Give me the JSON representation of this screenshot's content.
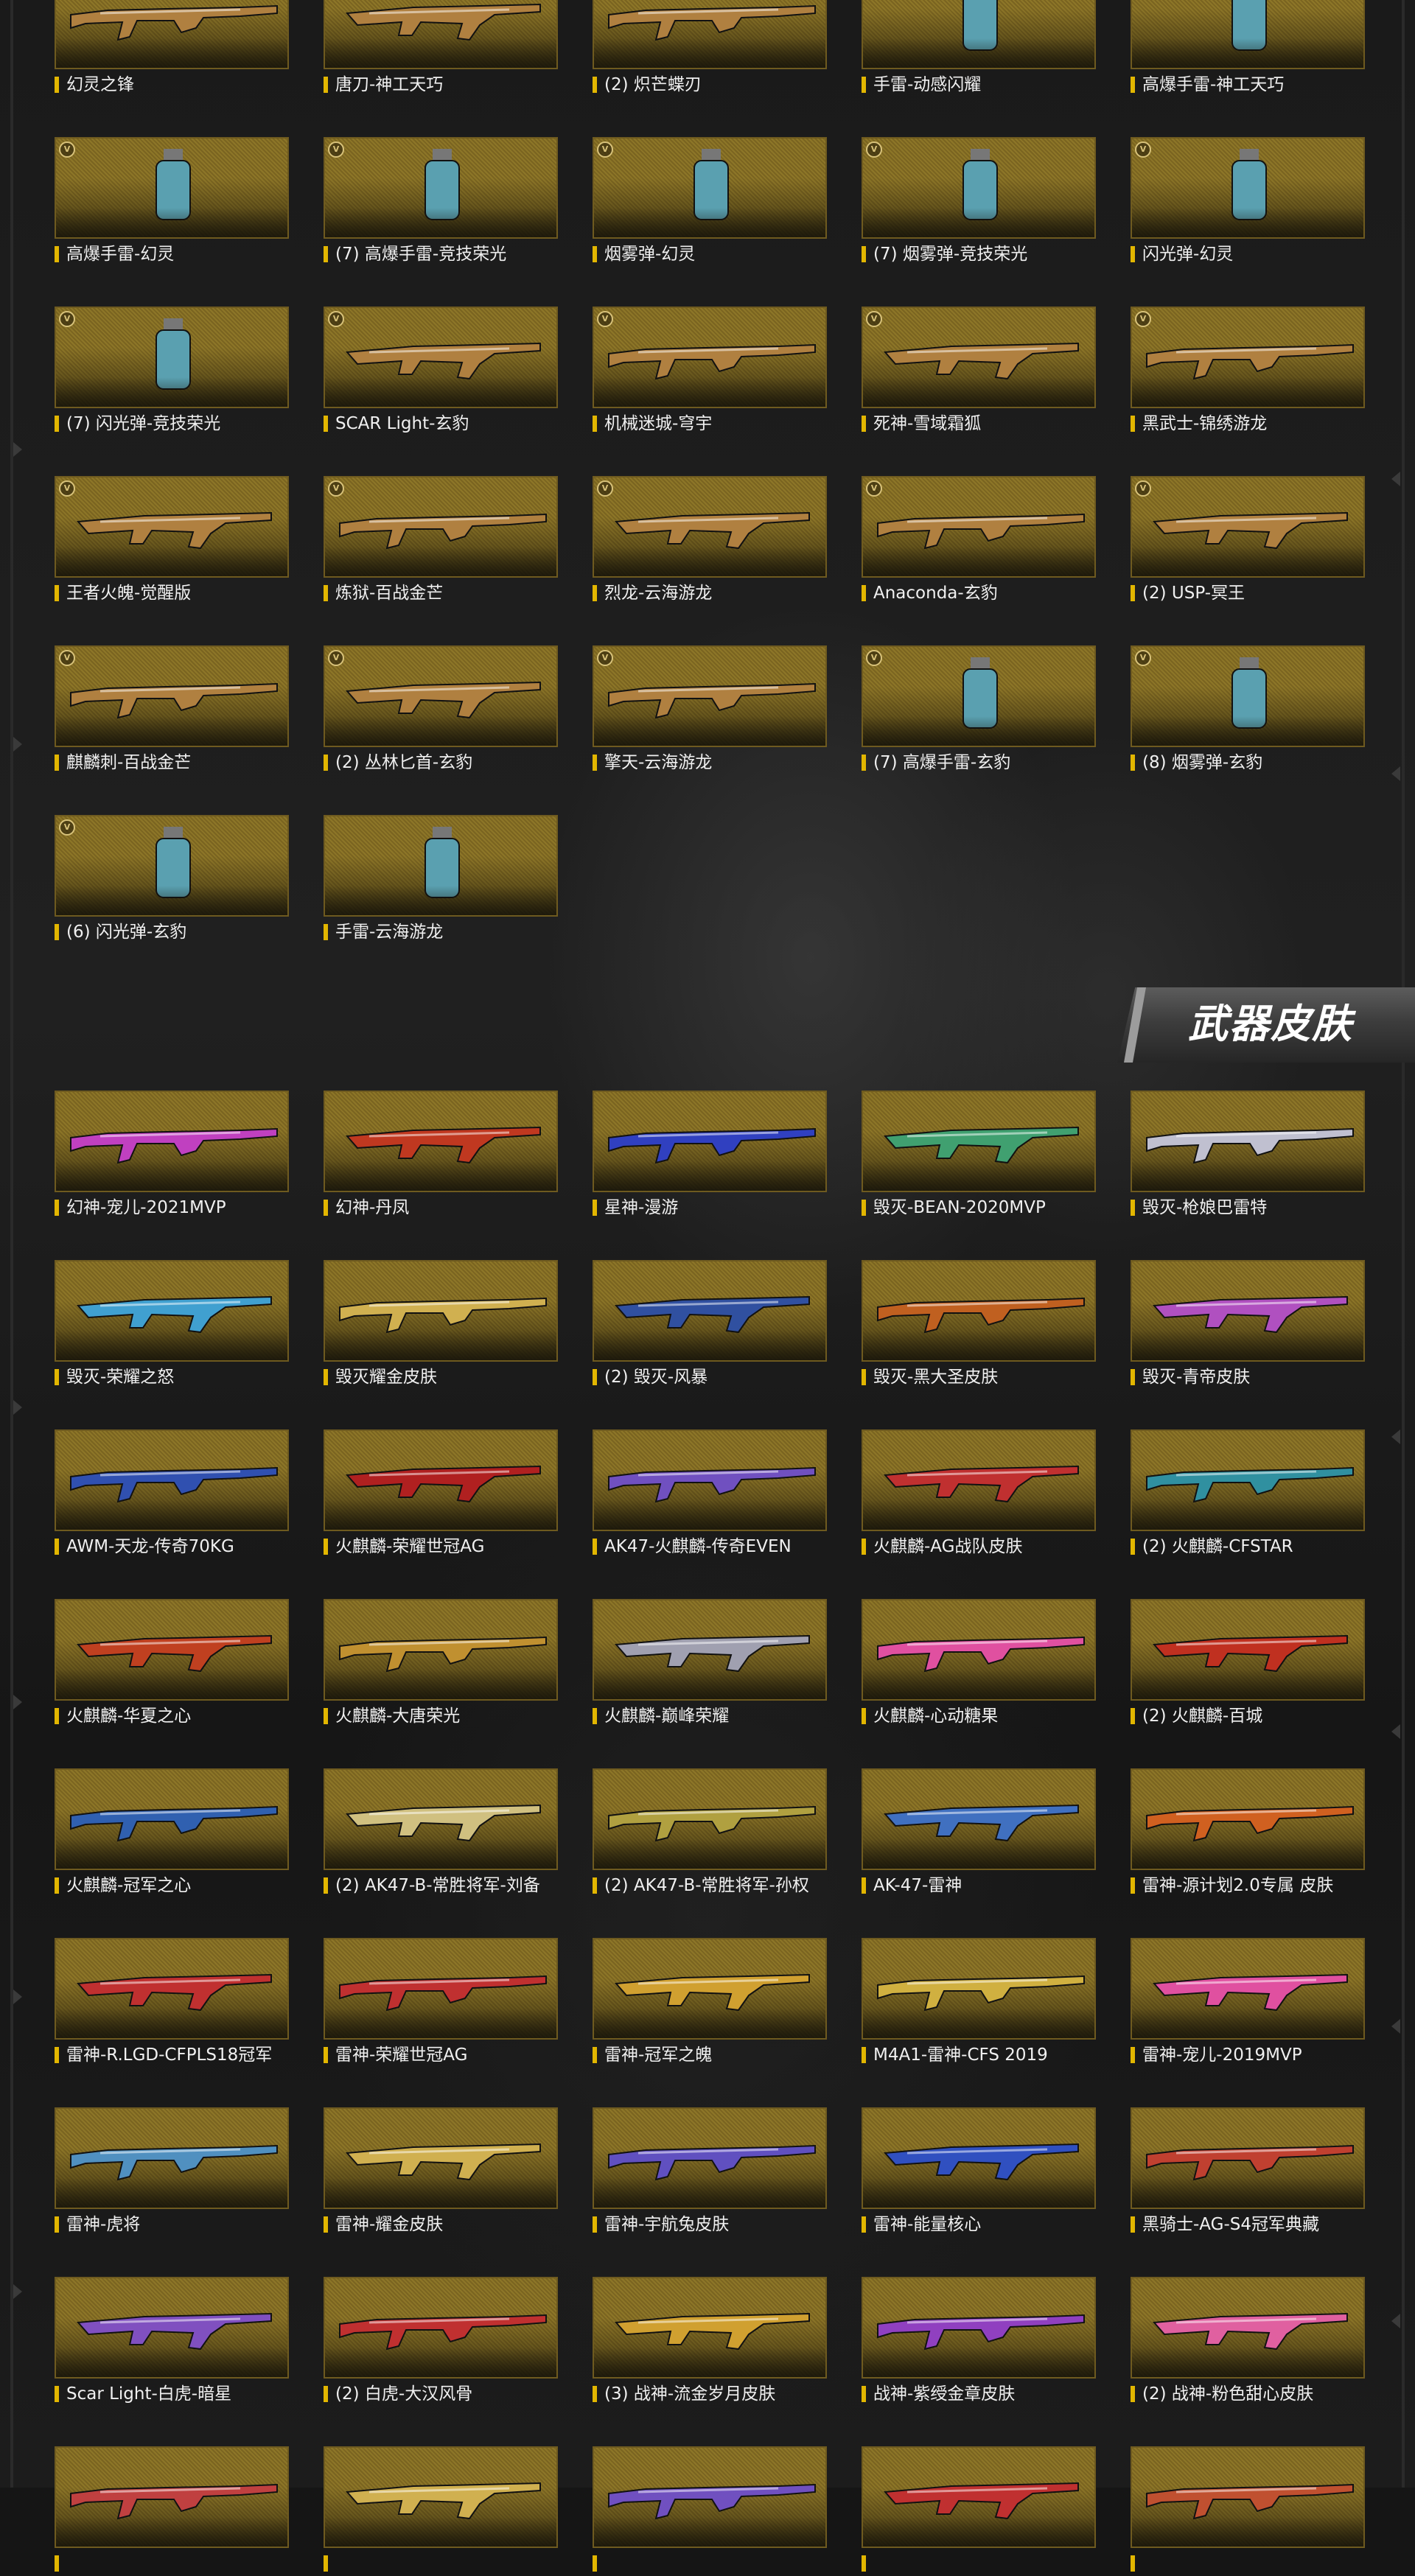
{
  "section_title": "武器皮肤",
  "badge_label": "V",
  "colors": {
    "label_bar": "#e2b600",
    "card_gold": "#8d7628",
    "card_border": "#6e5a1f",
    "text": "#f0f0f0"
  },
  "top_items": [
    {
      "name": "幻灵之锋",
      "icon": "knife-icon",
      "badge": true
    },
    {
      "name": "唐刀-神工天巧",
      "icon": "sword-icon",
      "badge": true
    },
    {
      "name": "(2) 炽芒蝶刃",
      "icon": "blade-icon",
      "badge": true
    },
    {
      "name": "手雷-动感闪耀",
      "icon": "disco-ball-grenade-icon",
      "badge": true
    },
    {
      "name": "高爆手雷-神工天巧",
      "icon": "grenade-icon",
      "badge": true
    },
    {
      "name": "高爆手雷-幻灵",
      "icon": "grenade-icon",
      "badge": true
    },
    {
      "name": "(7) 高爆手雷-竞技荣光",
      "icon": "grenade-icon",
      "badge": true
    },
    {
      "name": "烟雾弹-幻灵",
      "icon": "smoke-grenade-icon",
      "badge": true
    },
    {
      "name": "(7) 烟雾弹-竞技荣光",
      "icon": "smoke-grenade-icon",
      "badge": true
    },
    {
      "name": "闪光弹-幻灵",
      "icon": "flash-grenade-icon",
      "badge": true
    },
    {
      "name": "(7) 闪光弹-竞技荣光",
      "icon": "flash-grenade-icon",
      "badge": true
    },
    {
      "name": "SCAR Light-玄豹",
      "icon": "rifle-icon",
      "badge": true
    },
    {
      "name": "机械迷城-穹宇",
      "icon": "rifle-icon",
      "badge": true
    },
    {
      "name": "死神-雪域霜狐",
      "icon": "rifle-icon",
      "badge": true
    },
    {
      "name": "黑武士-锦绣游龙",
      "icon": "rifle-icon",
      "badge": true
    },
    {
      "name": "王者火魄-觉醒版",
      "icon": "rifle-icon",
      "badge": true
    },
    {
      "name": "炼狱-百战金芒",
      "icon": "rifle-icon",
      "badge": true
    },
    {
      "name": "烈龙-云海游龙",
      "icon": "rifle-icon",
      "badge": true
    },
    {
      "name": "Anaconda-玄豹",
      "icon": "revolver-icon",
      "badge": true
    },
    {
      "name": "(2) USP-冥王",
      "icon": "pistol-icon",
      "badge": true
    },
    {
      "name": "麒麟刺-百战金芒",
      "icon": "melee-icon",
      "badge": true
    },
    {
      "name": "(2) 丛林匕首-玄豹",
      "icon": "knife-icon",
      "badge": true
    },
    {
      "name": "擎天-云海游龙",
      "icon": "melee-icon",
      "badge": true
    },
    {
      "name": "(7) 高爆手雷-玄豹",
      "icon": "grenade-icon",
      "badge": true
    },
    {
      "name": "(8) 烟雾弹-玄豹",
      "icon": "smoke-grenade-icon",
      "badge": true
    },
    {
      "name": "(6) 闪光弹-玄豹",
      "icon": "flash-grenade-icon",
      "badge": true
    },
    {
      "name": "手雷-云海游龙",
      "icon": "grenade-icon",
      "badge": false
    }
  ],
  "skin_items": [
    {
      "name": "幻神-宠儿-2021MVP",
      "color": "#c040c0"
    },
    {
      "name": "幻神-丹凤",
      "color": "#c03820"
    },
    {
      "name": "星神-漫游",
      "color": "#3040c0"
    },
    {
      "name": "毁灭-BEAN-2020MVP",
      "color": "#40a070"
    },
    {
      "name": "毁灭-枪娘巴雷特",
      "color": "#c0c0d0"
    },
    {
      "name": "毁灭-荣耀之怒",
      "color": "#40a0d0"
    },
    {
      "name": "毁灭耀金皮肤",
      "color": "#d0b050"
    },
    {
      "name": "(2) 毁灭-风暴",
      "color": "#3050a0"
    },
    {
      "name": "毁灭-黑大圣皮肤",
      "color": "#c06020"
    },
    {
      "name": "毁灭-青帝皮肤",
      "color": "#b050c0"
    },
    {
      "name": "AWM-天龙-传奇70KG",
      "color": "#3050b0"
    },
    {
      "name": "火麒麟-荣耀世冠AG",
      "color": "#b02020"
    },
    {
      "name": "AK47-火麒麟-传奇EVEN",
      "color": "#7050c0"
    },
    {
      "name": "火麒麟-AG战队皮肤",
      "color": "#c03030"
    },
    {
      "name": "(2) 火麒麟-CFSTAR",
      "color": "#3090a0"
    },
    {
      "name": "火麒麟-华夏之心",
      "color": "#c04020"
    },
    {
      "name": "火麒麟-大唐荣光",
      "color": "#c09030"
    },
    {
      "name": "火麒麟-巅峰荣耀",
      "color": "#a0a0b0"
    },
    {
      "name": "火麒麟-心动糖果",
      "color": "#e050a0"
    },
    {
      "name": "(2) 火麒麟-百城",
      "color": "#c03020"
    },
    {
      "name": "火麒麟-冠军之心",
      "color": "#3060b0"
    },
    {
      "name": "(2) AK47-B-常胜将军-刘备",
      "color": "#d0c080"
    },
    {
      "name": "(2) AK47-B-常胜将军-孙权",
      "color": "#b0a040"
    },
    {
      "name": "AK-47-雷神",
      "color": "#4070c0"
    },
    {
      "name": "雷神-源计划2.0专属 皮肤",
      "color": "#d06020"
    },
    {
      "name": "雷神-R.LGD-CFPLS18冠军",
      "color": "#c03030"
    },
    {
      "name": "雷神-荣耀世冠AG",
      "color": "#c03030"
    },
    {
      "name": "雷神-冠军之魄",
      "color": "#d0a030"
    },
    {
      "name": "M4A1-雷神-CFS 2019",
      "color": "#d0b040"
    },
    {
      "name": "雷神-宠儿-2019MVP",
      "color": "#e050a0"
    },
    {
      "name": "雷神-虎将",
      "color": "#5090c0"
    },
    {
      "name": "雷神-耀金皮肤",
      "color": "#d0b050"
    },
    {
      "name": "雷神-宇航兔皮肤",
      "color": "#6050c0"
    },
    {
      "name": "雷神-能量核心",
      "color": "#3050c0"
    },
    {
      "name": "黑骑士-AG-S4冠军典藏",
      "color": "#c04030"
    },
    {
      "name": "Scar Light-白虎-暗星",
      "color": "#8050c0"
    },
    {
      "name": "(2) 白虎-大汉风骨",
      "color": "#c03030"
    },
    {
      "name": "(3) 战神-流金岁月皮肤",
      "color": "#d0a030"
    },
    {
      "name": "战神-紫绶金章皮肤",
      "color": "#9040c0"
    },
    {
      "name": "(2) 战神-粉色甜心皮肤",
      "color": "#e060a0"
    },
    {
      "name": "",
      "color": "#c04040"
    },
    {
      "name": "",
      "color": "#d0b050"
    },
    {
      "name": "",
      "color": "#7050c0"
    },
    {
      "name": "",
      "color": "#c03030"
    },
    {
      "name": "",
      "color": "#c05030"
    }
  ]
}
